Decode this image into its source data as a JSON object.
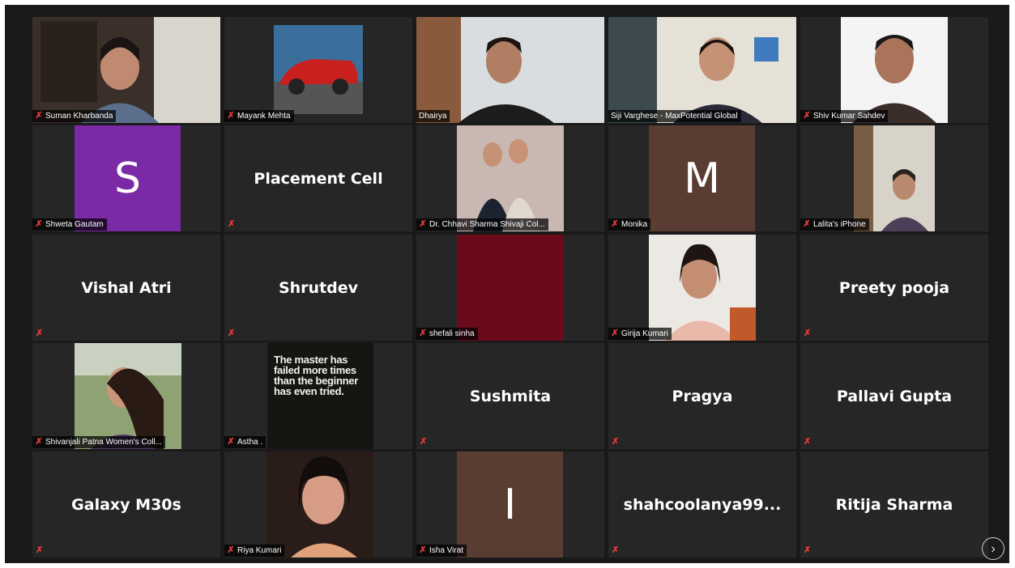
{
  "gallery": {
    "tiles": [
      {
        "name": "Suman Kharbanda"
      },
      {
        "name": "Mayank Mehta"
      },
      {
        "name": "Dhairya"
      },
      {
        "name": "Siji Varghese - MaxPotential Global"
      },
      {
        "name": "Shiv Kumar Sahdev"
      },
      {
        "name": "Shweta Gautam",
        "avatar_letter": "S"
      },
      {
        "display_name": "Placement Cell"
      },
      {
        "name": "Dr. Chhavi Sharma Shivaji Col..."
      },
      {
        "name": "Monika",
        "avatar_letter": "M"
      },
      {
        "name": "Lalita's iPhone"
      },
      {
        "display_name": "Vishal Atri"
      },
      {
        "display_name": "Shrutdev"
      },
      {
        "name": "shefali sinha"
      },
      {
        "name": "Girija Kumari"
      },
      {
        "display_name": "Preety pooja"
      },
      {
        "name": "Shivanjali Patna Women's Coll..."
      },
      {
        "name": "Astha .",
        "quote": "The master has failed more times than the beginner has even tried."
      },
      {
        "display_name": "Sushmita"
      },
      {
        "display_name": "Pragya"
      },
      {
        "display_name": "Pallavi Gupta"
      },
      {
        "display_name": "Galaxy M30s"
      },
      {
        "name": "Riya Kumari"
      },
      {
        "name": "Isha Virat",
        "avatar_letter": "I"
      },
      {
        "display_name": "shahcoolanya99..."
      },
      {
        "display_name": "Ritija Sharma"
      }
    ]
  },
  "icons": {
    "muted_mic": "muted-mic-icon",
    "next_page": "chevron-right-icon"
  },
  "colors": {
    "background": "#1a1a1a",
    "tile": "#262626",
    "active_speaker_border": "#d7e04a",
    "muted_icon": "#e8383d",
    "avatar_purple": "#7b2aa6",
    "avatar_brown": "#5a3d32",
    "shefali_crimson": "#6a0a1b"
  },
  "controls": {
    "next_page_glyph": "›"
  }
}
